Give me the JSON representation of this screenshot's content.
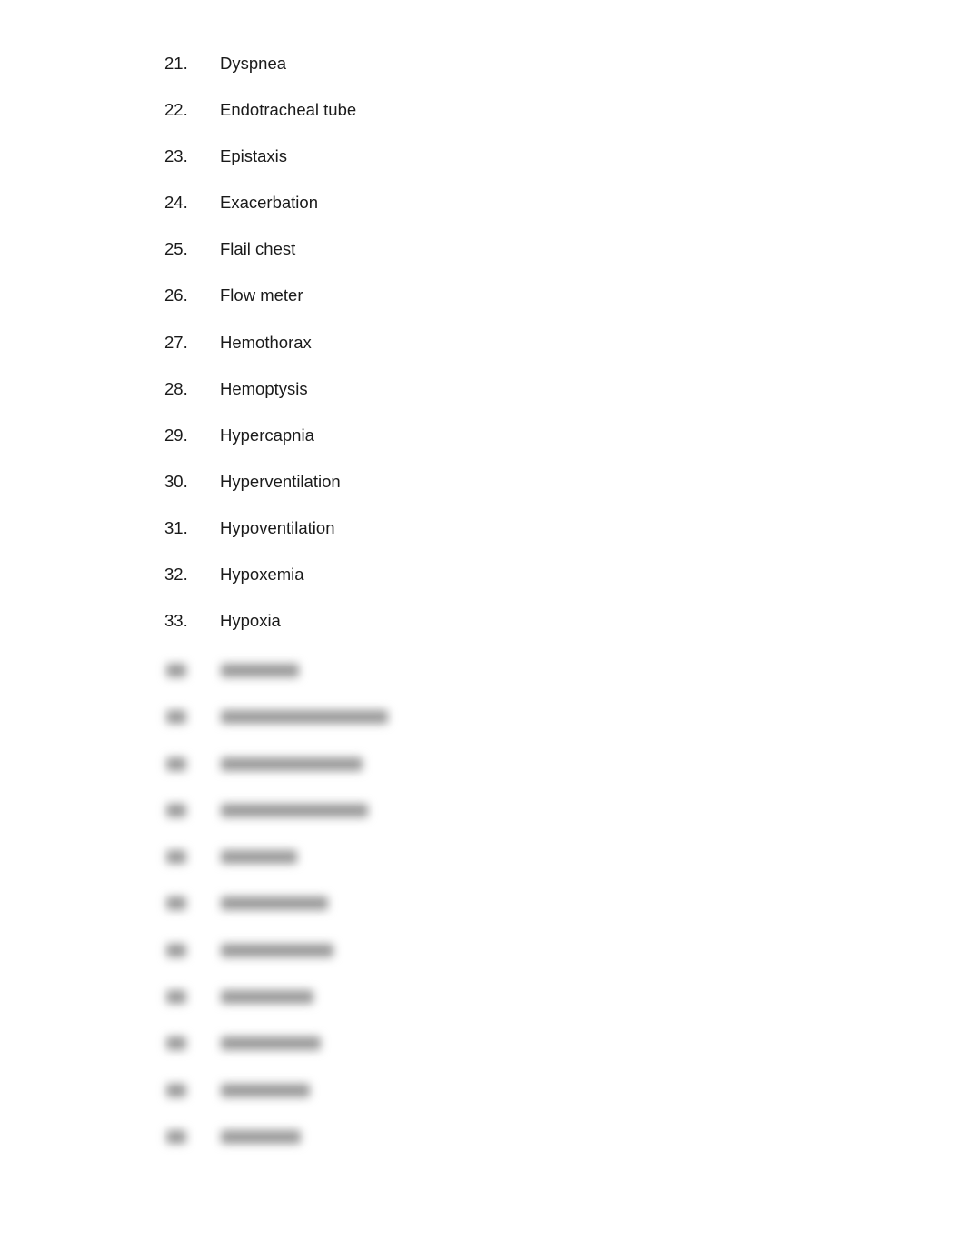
{
  "document": {
    "visible_items": [
      {
        "number": "21.",
        "term": "Dyspnea"
      },
      {
        "number": "22.",
        "term": "Endotracheal tube"
      },
      {
        "number": "23.",
        "term": "Epistaxis"
      },
      {
        "number": "24.",
        "term": "Exacerbation"
      },
      {
        "number": "25.",
        "term": "Flail chest"
      },
      {
        "number": "26.",
        "term": "Flow meter"
      },
      {
        "number": "27.",
        "term": "Hemothorax"
      },
      {
        "number": "28.",
        "term": "Hemoptysis"
      },
      {
        "number": "29.",
        "term": "Hypercapnia"
      },
      {
        "number": "30.",
        "term": "Hyperventilation"
      },
      {
        "number": "31.",
        "term": "Hypoventilation"
      },
      {
        "number": "32.",
        "term": "Hypoxemia"
      },
      {
        "number": "33.",
        "term": "Hypoxia"
      }
    ],
    "blurred_item_count": 11,
    "blurred_note": "Items 34–44 are blurred and unreadable"
  }
}
